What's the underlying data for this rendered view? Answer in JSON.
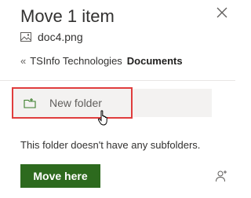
{
  "dialog": {
    "title": "Move 1 item",
    "file_name": "doc4.png",
    "file_icon": "image-icon",
    "close_icon": "close-icon"
  },
  "breadcrumb": {
    "back_glyph": "«",
    "parent": "TSInfo Technologies",
    "current": "Documents"
  },
  "new_folder": {
    "label": "New folder",
    "icon": "add-folder-icon"
  },
  "message": "This folder doesn't have any subfolders.",
  "actions": {
    "move_label": "Move here",
    "move_color": "#2d6a1e",
    "person_icon": "person-icon"
  },
  "colors": {
    "highlight_border": "#e03d3d",
    "new_folder_bg": "#f3f2f1",
    "accent_green": "#2d6a1e"
  }
}
